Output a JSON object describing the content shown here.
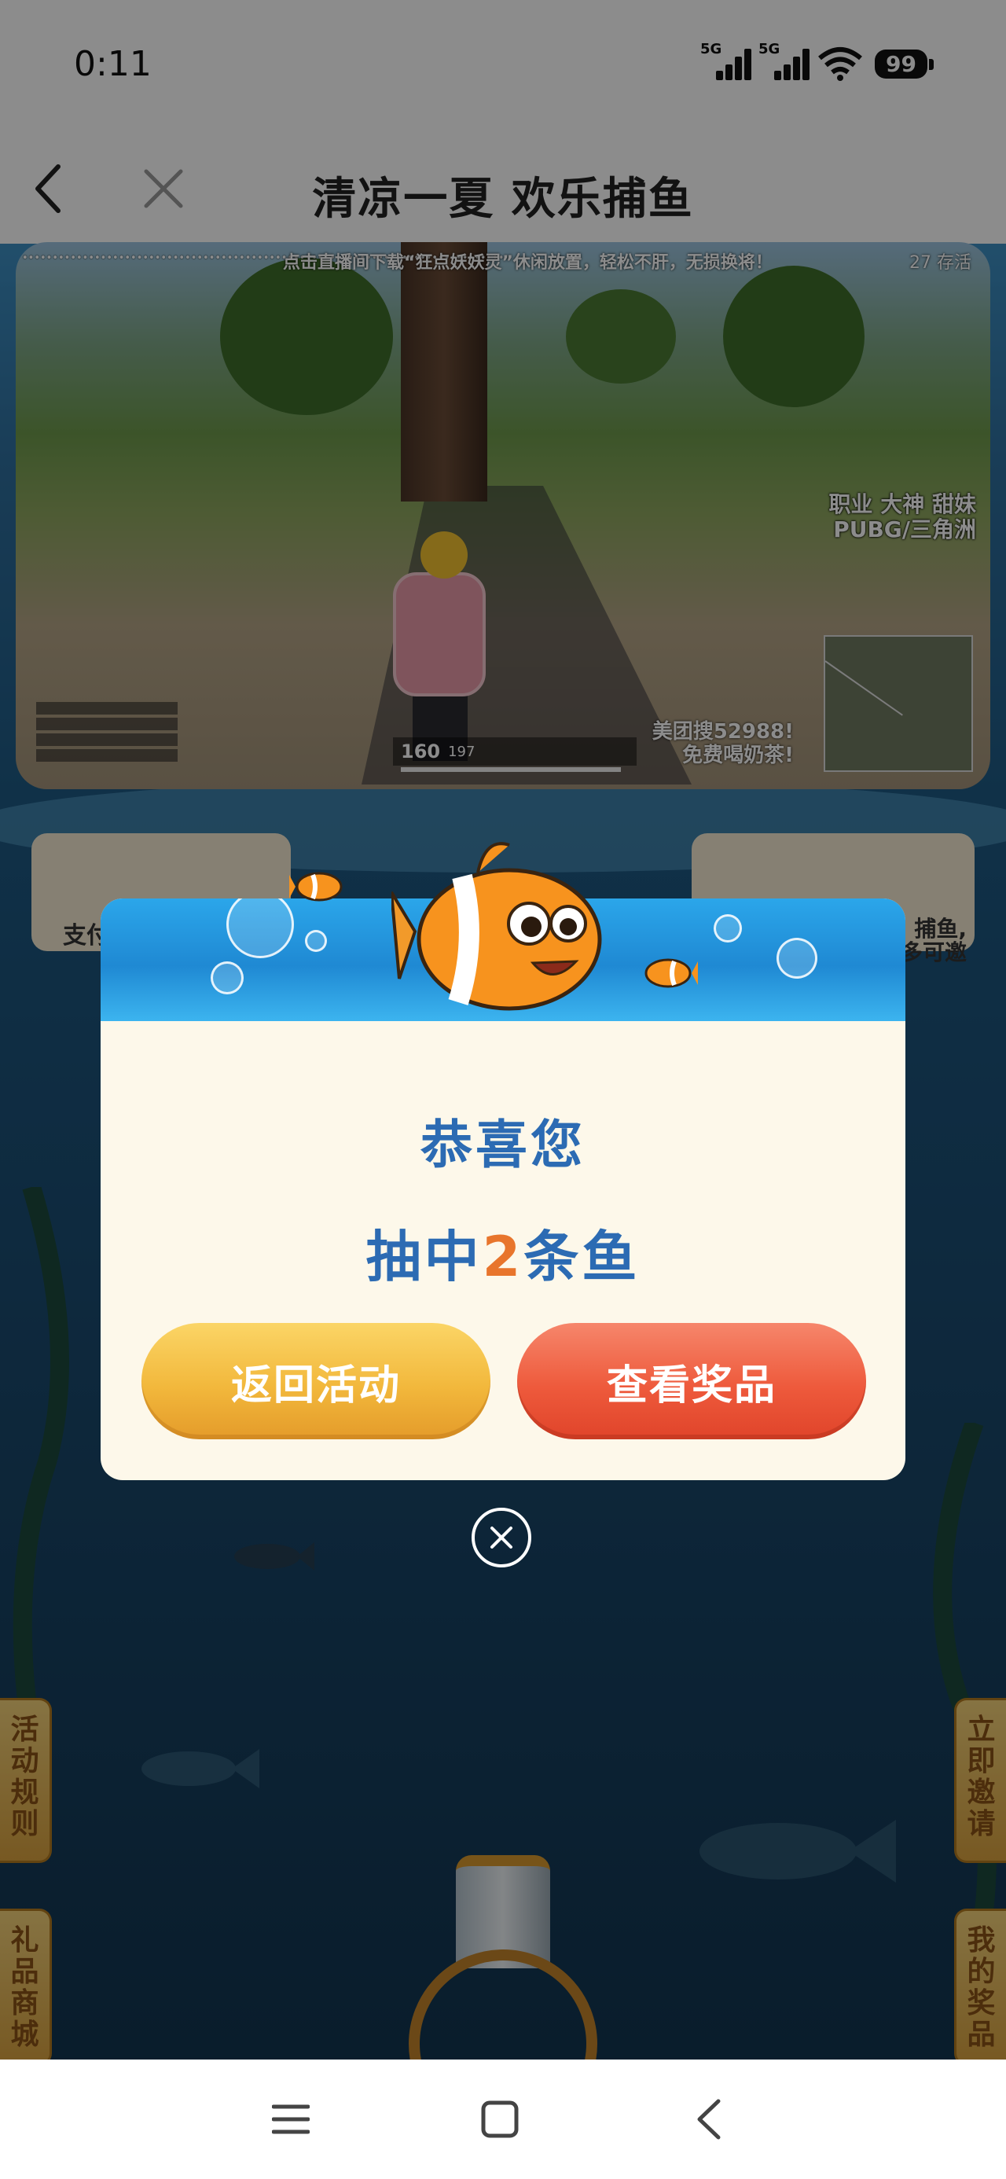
{
  "status": {
    "time": "0:11",
    "network1": "5G",
    "network2": "5G",
    "battery": "99"
  },
  "titlebar": {
    "title": "清凉一夏 欢乐捕鱼"
  },
  "video": {
    "top_text": "点击直播间下载“狂点妖妖灵”休闲放置，轻松不肝，无损换将！",
    "top_right": "27 存活",
    "streamer_line1": "职业 大神 甜妹",
    "streamer_line2": "PUBG/三角洲",
    "promo_line1": "美团搜52988!",
    "promo_line2": "免费喝奶茶!",
    "hud_ammo": "160",
    "hud_reserve": "197"
  },
  "background": {
    "left_partial": "支付",
    "right_partial1": "捕鱼,",
    "right_partial2": "多可邀"
  },
  "side_tabs": {
    "rules": "活动规则",
    "shop": "礼品商城",
    "invite": "立即邀请",
    "my_prizes": "我的奖品"
  },
  "modal": {
    "congrats": "恭喜您",
    "result_prefix": "抽中",
    "result_number": "2",
    "result_suffix": "条鱼",
    "back_button": "返回活动",
    "view_button": "查看奖品"
  },
  "colors": {
    "title_blue": "#2c6bb3",
    "number_orange": "#e8752c",
    "btn_gold": "#f2b83c",
    "btn_red": "#ee5a3c"
  }
}
